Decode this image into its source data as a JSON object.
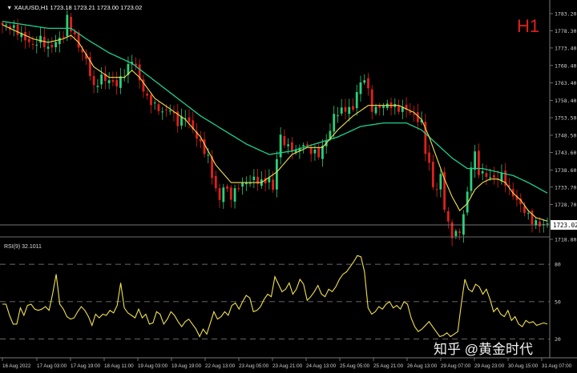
{
  "header": {
    "symbol": "XAUUSD,H1",
    "ohlc": "1723.18 1723.21 1723.00 1723.02",
    "timeframe_badge": "H1",
    "badge_color": "#e0201c"
  },
  "indicator": {
    "label": "RSI(9) 32.1011",
    "levels": [
      "80",
      "50",
      "20"
    ]
  },
  "watermark": "知乎 @黄金时代",
  "colors": {
    "background": "#000000",
    "bull_candle": "#2bd07a",
    "bear_candle": "#e0201c",
    "fast_ma": "#f0e050",
    "slow_ma": "#1ecf8f",
    "rsi_line": "#f0e050",
    "grid_text": "#d0d0d0",
    "current_price_box": "#ffffff"
  },
  "chart_data": {
    "type": "line",
    "price_axis_ticks": [
      "1783.20",
      "1778.30",
      "1773.40",
      "1768.40",
      "1763.40",
      "1758.40",
      "1753.50",
      "1748.50",
      "1743.60",
      "1738.60",
      "1733.70",
      "1728.70",
      "1723.02",
      "1718.80"
    ],
    "current_price": "1723.02",
    "time_ticks": [
      "16 Aug 2022",
      "17 Aug 03:00",
      "17 Aug 19:00",
      "18 Aug 11:00",
      "19 Aug 03:00",
      "19 Aug 19:00",
      "22 Aug 13:00",
      "23 Aug 05:00",
      "23 Aug 21:00",
      "24 Aug 13:00",
      "25 Aug 05:00",
      "25 Aug 21:00",
      "26 Aug 13:00",
      "29 Aug 07:00",
      "29 Aug 23:00",
      "30 Aug 15:00",
      "31 Aug 07:00"
    ],
    "ylim": [
      1718.8,
      1783.2
    ],
    "close_path": [
      [
        0,
        1780
      ],
      [
        3,
        1779
      ],
      [
        6,
        1776
      ],
      [
        8,
        1774
      ],
      [
        10,
        1776
      ],
      [
        12,
        1773
      ],
      [
        14,
        1775
      ],
      [
        16,
        1777
      ],
      [
        17,
        1782
      ],
      [
        18,
        1779
      ],
      [
        20,
        1774
      ],
      [
        22,
        1770
      ],
      [
        23,
        1766
      ],
      [
        24,
        1762
      ],
      [
        26,
        1765
      ],
      [
        28,
        1764
      ],
      [
        30,
        1763
      ],
      [
        32,
        1766
      ],
      [
        34,
        1770
      ],
      [
        35,
        1768
      ],
      [
        36,
        1764
      ],
      [
        38,
        1759
      ],
      [
        40,
        1757
      ],
      [
        42,
        1755
      ],
      [
        44,
        1756
      ],
      [
        46,
        1752
      ],
      [
        48,
        1754
      ],
      [
        50,
        1750
      ],
      [
        52,
        1746
      ],
      [
        54,
        1742
      ],
      [
        55,
        1737
      ],
      [
        56,
        1733
      ],
      [
        57,
        1730
      ],
      [
        58,
        1734
      ],
      [
        60,
        1731
      ],
      [
        62,
        1734
      ],
      [
        64,
        1735
      ],
      [
        66,
        1736
      ],
      [
        68,
        1735
      ],
      [
        70,
        1736
      ],
      [
        71,
        1733
      ],
      [
        72,
        1742
      ],
      [
        73,
        1748
      ],
      [
        75,
        1745
      ],
      [
        77,
        1744
      ],
      [
        79,
        1746
      ],
      [
        81,
        1744
      ],
      [
        83,
        1743
      ],
      [
        85,
        1747
      ],
      [
        86,
        1750
      ],
      [
        87,
        1754
      ],
      [
        88,
        1755
      ],
      [
        90,
        1756
      ],
      [
        92,
        1756
      ],
      [
        93,
        1761
      ],
      [
        94,
        1763
      ],
      [
        95,
        1765
      ],
      [
        96,
        1761
      ],
      [
        97,
        1756
      ],
      [
        98,
        1756
      ],
      [
        100,
        1757
      ],
      [
        102,
        1757
      ],
      [
        104,
        1756
      ],
      [
        106,
        1756
      ],
      [
        108,
        1754
      ],
      [
        110,
        1752
      ],
      [
        111,
        1744
      ],
      [
        112,
        1740
      ],
      [
        113,
        1734
      ],
      [
        114,
        1733
      ],
      [
        115,
        1737
      ],
      [
        116,
        1728
      ],
      [
        117,
        1723
      ],
      [
        118,
        1720
      ],
      [
        120,
        1721
      ],
      [
        121,
        1726
      ],
      [
        122,
        1732
      ],
      [
        123,
        1740
      ],
      [
        124,
        1743
      ],
      [
        125,
        1738
      ],
      [
        127,
        1737
      ],
      [
        129,
        1736
      ],
      [
        131,
        1737
      ],
      [
        133,
        1733
      ],
      [
        135,
        1730
      ],
      [
        137,
        1727
      ],
      [
        139,
        1724
      ],
      [
        141,
        1723
      ],
      [
        143,
        1723.02
      ]
    ],
    "fast_ma_path": [
      [
        0,
        1780
      ],
      [
        4,
        1778
      ],
      [
        8,
        1776
      ],
      [
        12,
        1775
      ],
      [
        16,
        1776
      ],
      [
        18,
        1777
      ],
      [
        20,
        1775
      ],
      [
        24,
        1768
      ],
      [
        28,
        1765
      ],
      [
        32,
        1765
      ],
      [
        34,
        1767
      ],
      [
        36,
        1765
      ],
      [
        40,
        1759
      ],
      [
        44,
        1756
      ],
      [
        48,
        1753
      ],
      [
        52,
        1748
      ],
      [
        56,
        1740
      ],
      [
        60,
        1735
      ],
      [
        64,
        1735
      ],
      [
        68,
        1735
      ],
      [
        72,
        1738
      ],
      [
        76,
        1743
      ],
      [
        80,
        1745
      ],
      [
        84,
        1745
      ],
      [
        88,
        1750
      ],
      [
        92,
        1754
      ],
      [
        96,
        1757
      ],
      [
        100,
        1757
      ],
      [
        104,
        1757
      ],
      [
        108,
        1755
      ],
      [
        110,
        1753
      ],
      [
        112,
        1748
      ],
      [
        114,
        1742
      ],
      [
        116,
        1736
      ],
      [
        118,
        1731
      ],
      [
        120,
        1727
      ],
      [
        122,
        1729
      ],
      [
        124,
        1733
      ],
      [
        126,
        1735
      ],
      [
        128,
        1736
      ],
      [
        130,
        1736
      ],
      [
        132,
        1735
      ],
      [
        134,
        1732
      ],
      [
        136,
        1730
      ],
      [
        138,
        1727
      ],
      [
        140,
        1725
      ],
      [
        143,
        1724
      ]
    ],
    "slow_ma_path": [
      [
        0,
        1781
      ],
      [
        6,
        1780
      ],
      [
        12,
        1779
      ],
      [
        18,
        1779
      ],
      [
        22,
        1776
      ],
      [
        28,
        1772
      ],
      [
        34,
        1769
      ],
      [
        40,
        1764
      ],
      [
        46,
        1759
      ],
      [
        52,
        1754
      ],
      [
        58,
        1750
      ],
      [
        64,
        1746
      ],
      [
        70,
        1743
      ],
      [
        76,
        1744
      ],
      [
        82,
        1746
      ],
      [
        88,
        1748
      ],
      [
        94,
        1751
      ],
      [
        100,
        1752
      ],
      [
        106,
        1752
      ],
      [
        110,
        1750
      ],
      [
        114,
        1746
      ],
      [
        118,
        1742
      ],
      [
        122,
        1739
      ],
      [
        126,
        1739
      ],
      [
        130,
        1738
      ],
      [
        134,
        1737
      ],
      [
        138,
        1735
      ],
      [
        143,
        1732
      ]
    ],
    "rsi_values": [
      48,
      48,
      39,
      32,
      32,
      45,
      39,
      47,
      48,
      44,
      43,
      44,
      46,
      43,
      56,
      72,
      48,
      44,
      38,
      36,
      37,
      42,
      46,
      43,
      38,
      31,
      40,
      37,
      40,
      39,
      43,
      41,
      47,
      65,
      45,
      41,
      39,
      37,
      44,
      37,
      40,
      32,
      33,
      42,
      40,
      32,
      36,
      42,
      39,
      34,
      30,
      34,
      36,
      32,
      28,
      22,
      28,
      24,
      33,
      42,
      36,
      38,
      42,
      39,
      47,
      49,
      44,
      50,
      55,
      53,
      42,
      43,
      46,
      52,
      56,
      54,
      70,
      64,
      58,
      60,
      65,
      56,
      60,
      68,
      64,
      51,
      54,
      58,
      63,
      56,
      54,
      60,
      58,
      62,
      68,
      72,
      74,
      78,
      82,
      87,
      86,
      74,
      45,
      40,
      42,
      46,
      44,
      48,
      50,
      45,
      47,
      44,
      50,
      48,
      37,
      30,
      26,
      28,
      31,
      34,
      30,
      26,
      22,
      23,
      25,
      22,
      24,
      26,
      48,
      68,
      60,
      58,
      64,
      62,
      56,
      60,
      52,
      42,
      45,
      40,
      38,
      43,
      35,
      38,
      32,
      30,
      35,
      33,
      34,
      31,
      32,
      33,
      32
    ]
  }
}
